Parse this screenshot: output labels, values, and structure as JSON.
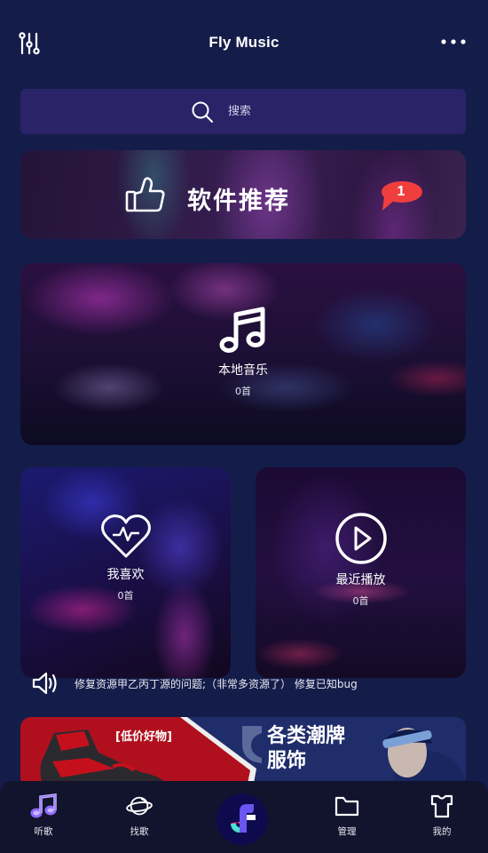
{
  "header": {
    "title": "Fly Music",
    "left_icon": "equalizer-icon",
    "right_icon": "more-icon"
  },
  "search": {
    "placeholder": "搜索",
    "value": "",
    "icon": "search-icon"
  },
  "recommend": {
    "label": "软件推荐",
    "icon": "thumbs-up-icon",
    "badge_count": "1",
    "badge_color": "#f03e3e"
  },
  "cards": {
    "local": {
      "name": "本地音乐",
      "count": "0首",
      "icon": "music-note-icon"
    },
    "favorites": {
      "name": "我喜欢",
      "count": "0首",
      "icon": "heart-pulse-icon"
    },
    "recent": {
      "name": "最近播放",
      "count": "0首",
      "icon": "play-circle-icon"
    }
  },
  "notice": {
    "icon": "speaker-icon",
    "text": "修复资源甲乙丙丁源的问题;（非常多资源了） 修复已知bug"
  },
  "promo": {
    "tag": "[低价好物]",
    "headline_line1": "各类潮牌",
    "headline_line2": "服饰"
  },
  "tabbar": {
    "items": [
      {
        "label": "听歌",
        "icon": "music-note-icon",
        "active": true
      },
      {
        "label": "找歌",
        "icon": "planet-icon",
        "active": false
      },
      {
        "label": "",
        "icon": "app-logo-icon",
        "active": false
      },
      {
        "label": "管理",
        "icon": "folder-icon",
        "active": false
      },
      {
        "label": "我的",
        "icon": "tshirt-icon",
        "active": false
      }
    ]
  },
  "colors": {
    "background": "#141d4a",
    "search_bg": "#2a2368",
    "tabbar_bg": "#12132c",
    "accent_purple": "#7a5cff"
  }
}
